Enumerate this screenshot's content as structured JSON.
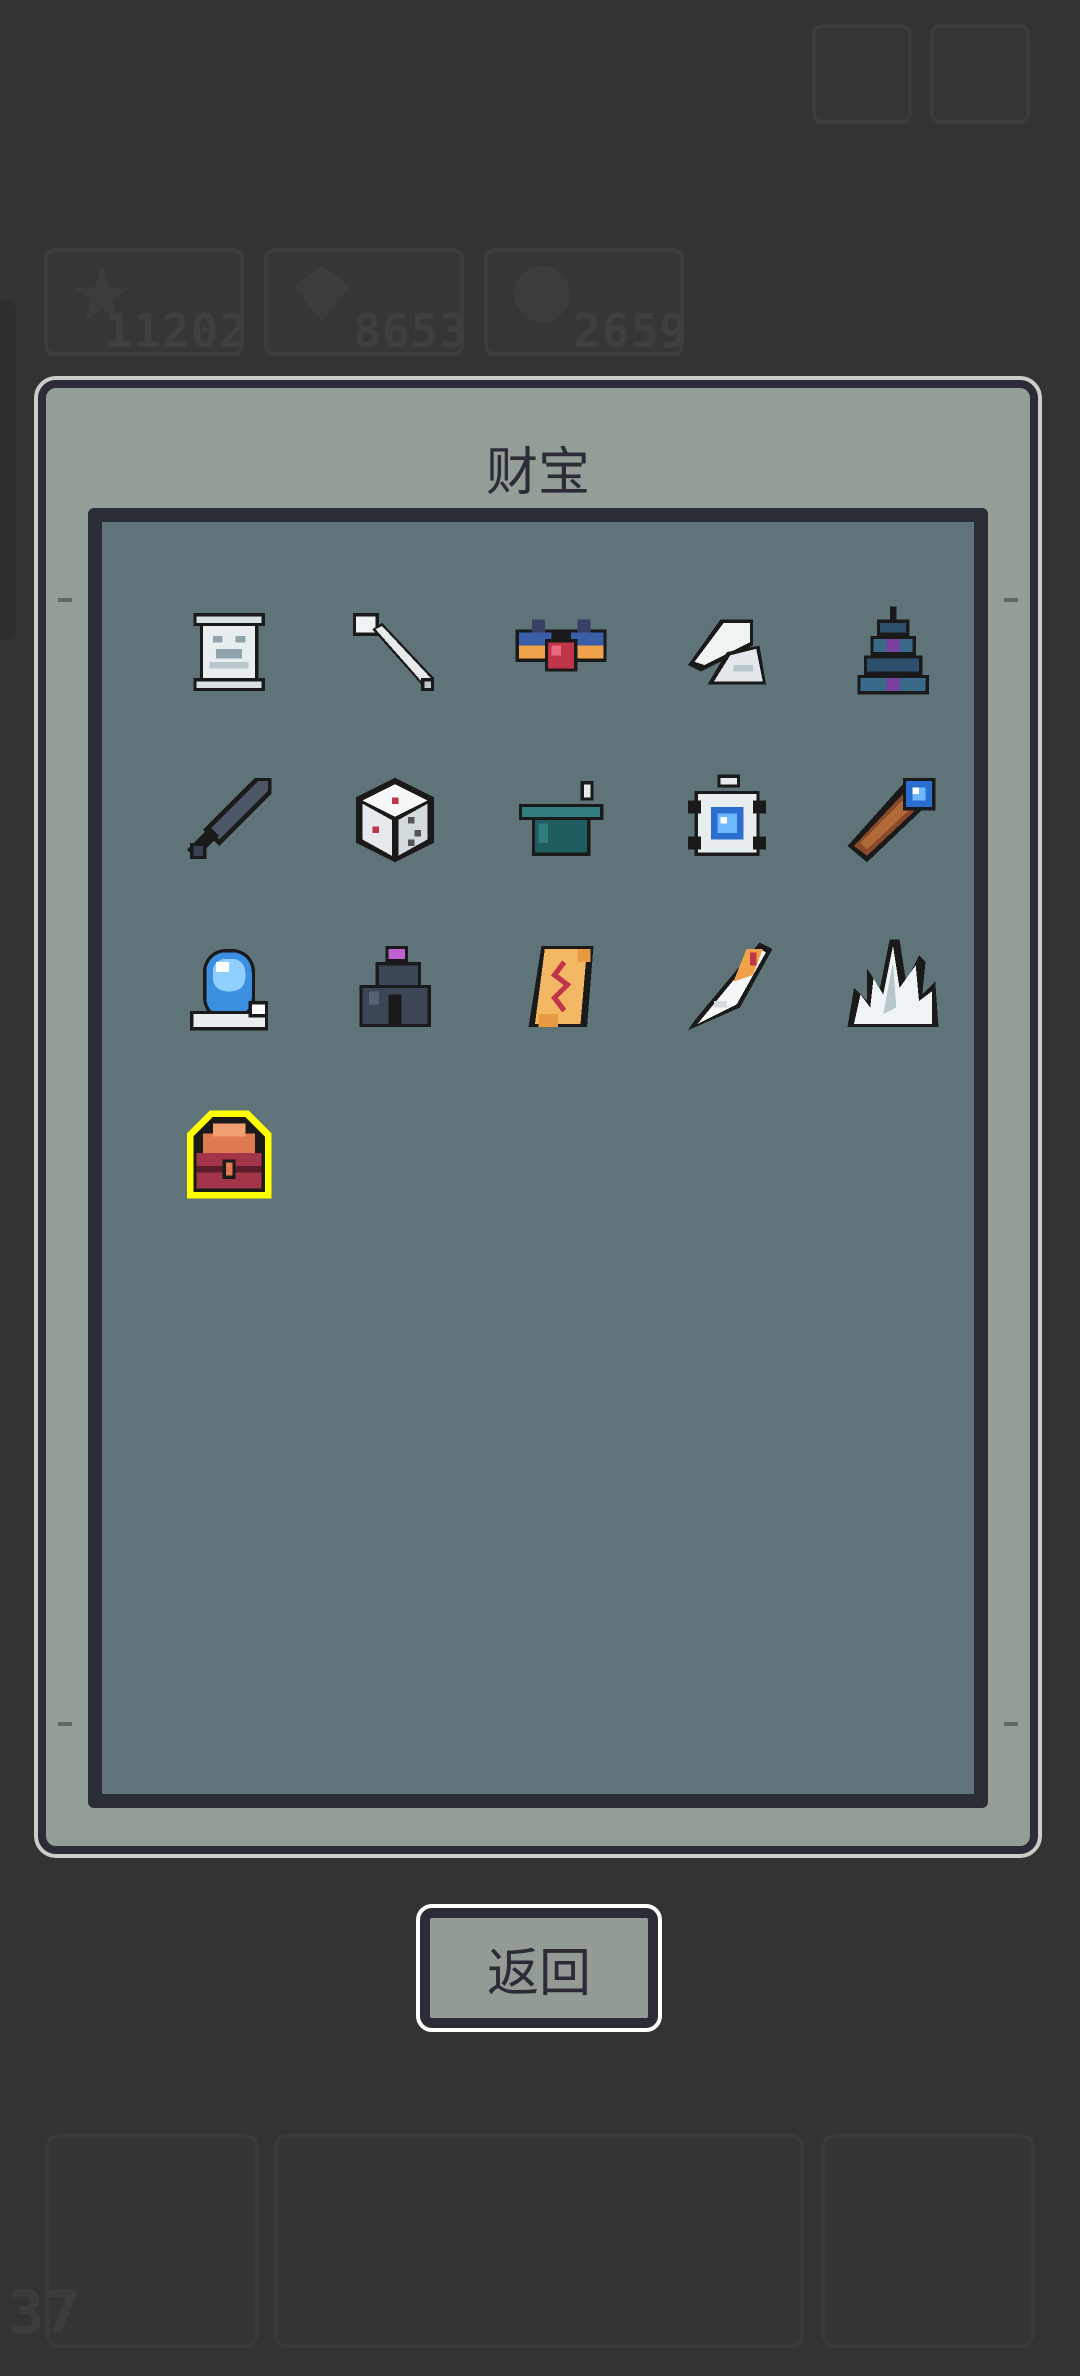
{
  "background_hud": {
    "stats": [
      {
        "icon": "star-icon",
        "value": "11202"
      },
      {
        "icon": "gem-icon",
        "value": "8653"
      },
      {
        "icon": "coin-icon",
        "value": "2659"
      }
    ],
    "level": "37"
  },
  "dialog": {
    "title": "财宝",
    "items": [
      {
        "name": "scroll-map-icon",
        "highlighted": false
      },
      {
        "name": "bone-key-icon",
        "highlighted": false
      },
      {
        "name": "winged-amulet-icon",
        "highlighted": false
      },
      {
        "name": "angel-wings-icon",
        "highlighted": false
      },
      {
        "name": "pagoda-tower-icon",
        "highlighted": false
      },
      {
        "name": "dark-sword-icon",
        "highlighted": false
      },
      {
        "name": "dice-icon",
        "highlighted": false
      },
      {
        "name": "cauldron-pot-icon",
        "highlighted": false
      },
      {
        "name": "blue-gem-relic-icon",
        "highlighted": false
      },
      {
        "name": "telescope-icon",
        "highlighted": false
      },
      {
        "name": "crystal-ball-icon",
        "highlighted": false
      },
      {
        "name": "dark-idol-icon",
        "highlighted": false
      },
      {
        "name": "ancient-scroll-icon",
        "highlighted": false
      },
      {
        "name": "feather-quill-icon",
        "highlighted": false
      },
      {
        "name": "ice-crystal-icon",
        "highlighted": false
      },
      {
        "name": "treasure-chest-icon",
        "highlighted": true
      }
    ]
  },
  "back_button": {
    "label": "返回"
  },
  "colors": {
    "panel": "#939e97",
    "inner": "#5f7479",
    "border": "#2b2c37",
    "highlight": "#ffff00"
  }
}
